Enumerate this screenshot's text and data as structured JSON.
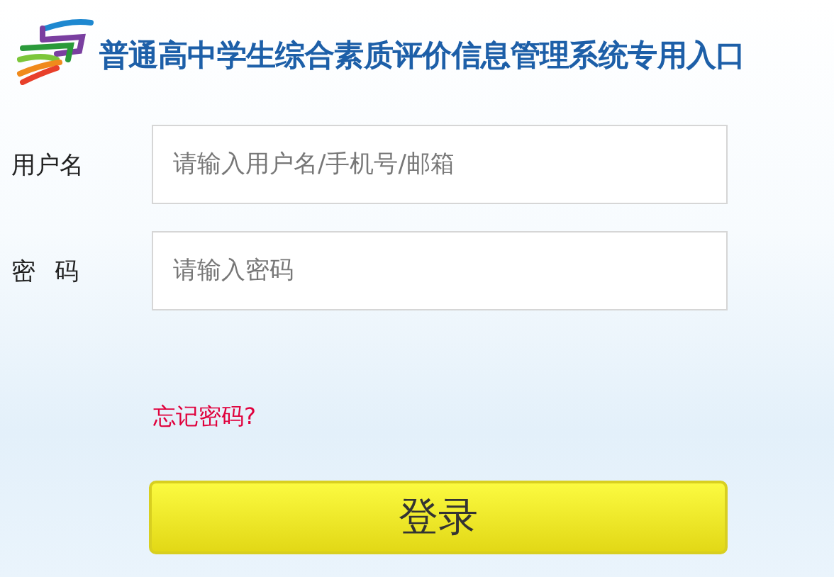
{
  "header": {
    "title": "普通高中学生综合素质评价信息管理系统专用入口"
  },
  "form": {
    "fields": [
      {
        "label": "用户名",
        "placeholder": "请输入用户名/手机号/邮箱"
      },
      {
        "label": "密 码",
        "placeholder": "请输入密码"
      }
    ],
    "forgot_link": "忘记密码?",
    "login_button": "登录"
  }
}
